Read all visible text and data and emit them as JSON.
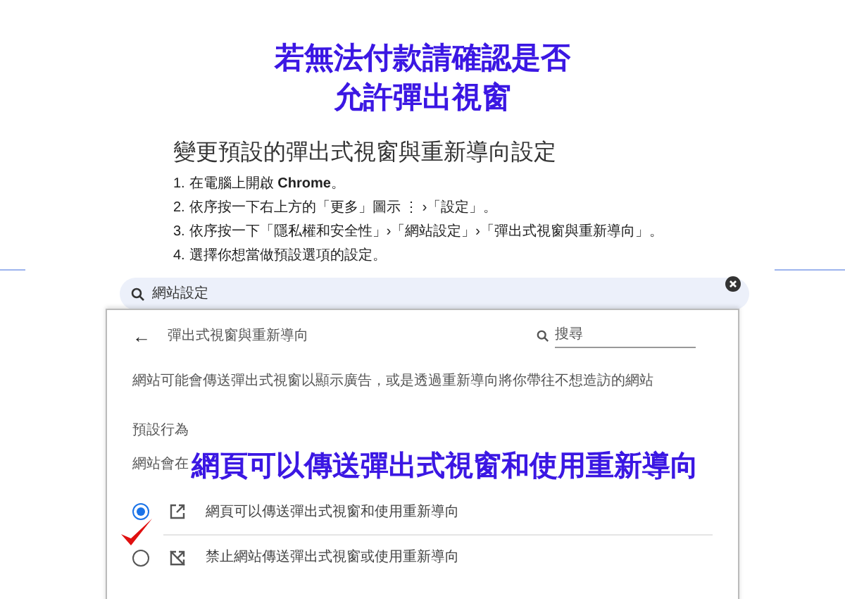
{
  "banner": {
    "lines": [
      "若無法付款請確認是否",
      "允許彈出視窗"
    ]
  },
  "help": {
    "heading": "變更預設的彈出式視窗與重新導向設定",
    "steps": [
      {
        "number": "1.",
        "text": "在電腦上開啟 **Chrome**。"
      },
      {
        "number": "2.",
        "text": "依序按一下右上方的「更多」圖示 ⋮ ›「設定」。"
      },
      {
        "number": "3.",
        "text": "依序按一下「隱私權和安全性」›「網站設定」›「彈出式視窗與重新導向」。"
      },
      {
        "number": "4.",
        "text": "選擇你想當做預設選項的設定。"
      }
    ]
  },
  "search": {
    "value": "網站設定"
  },
  "panel": {
    "back": "←",
    "title": "彈出式視窗與重新導向",
    "search_placeholder": "搜尋",
    "description": "網站可能會傳送彈出式視窗以顯示廣告，或是透過重新導向將你帶往不想造訪的網站",
    "section": "預設行為",
    "hint": "網站會在",
    "options": [
      {
        "kind": "allow",
        "label": "網頁可以傳送彈出式視窗和使用重新導向",
        "selected": true
      },
      {
        "kind": "block",
        "label": "禁止網站傳送彈出式視窗或使用重新導向",
        "selected": false
      }
    ]
  },
  "callout": "網頁可以傳送彈出式視窗和使用重新導向"
}
